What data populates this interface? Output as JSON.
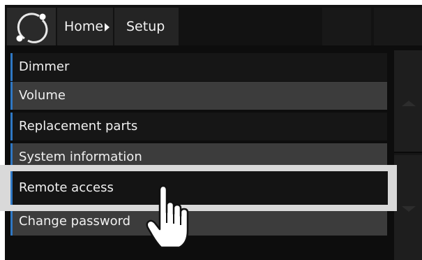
{
  "header": {
    "logo_icon": "ring-logo-icon",
    "breadcrumb": {
      "home_label": "Home",
      "separator_icon": "triangle-right-icon",
      "setup_label": "Setup"
    }
  },
  "menu": {
    "items": [
      {
        "label": "Dimmer"
      },
      {
        "label": "Volume"
      },
      {
        "label": "Replacement parts"
      },
      {
        "label": "System information"
      },
      {
        "label": "Remote access"
      },
      {
        "label": "Change password"
      }
    ],
    "highlighted_index": 4
  },
  "scrollbar": {
    "up_icon": "scroll-up-icon",
    "down_icon": "scroll-down-icon"
  },
  "pointer": {
    "icon": "hand-pointer-icon"
  },
  "colors": {
    "accent": "#2f78c4",
    "background": "#0d0d0d",
    "row_light": "#3c3c3c",
    "highlight_frame": "#d9d9d9"
  }
}
